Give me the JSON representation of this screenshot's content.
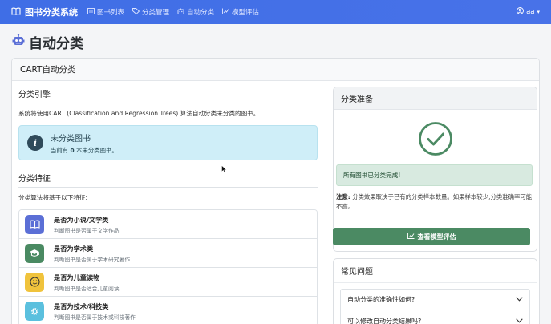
{
  "navbar": {
    "brand": "图书分类系统",
    "items": [
      {
        "label": "图书列表",
        "icon": "list-icon"
      },
      {
        "label": "分类管理",
        "icon": "tags-icon"
      },
      {
        "label": "自动分类",
        "icon": "robot-icon"
      },
      {
        "label": "模型评估",
        "icon": "chart-icon"
      }
    ],
    "user": "aa"
  },
  "page": {
    "title": "自动分类",
    "icon": "robot-icon"
  },
  "main_card": {
    "header": "CART自动分类"
  },
  "engine": {
    "title": "分类引擎",
    "description": "系统将使用CART (Classification and Regression Trees) 算法自动分类未分类的图书。",
    "alert_title": "未分类图书",
    "alert_prefix": "当前有 ",
    "alert_count": "0",
    "alert_suffix": " 本未分类图书。"
  },
  "features": {
    "title": "分类特征",
    "intro": "分类算法将基于以下特征:",
    "items": [
      {
        "title": "是否为小说/文学类",
        "sub": "判断图书是否属于文学作品",
        "icon": "book-icon",
        "color": "#5b6fd6"
      },
      {
        "title": "是否为学术类",
        "sub": "判断图书是否属于学术研究著作",
        "icon": "graduation-cap-icon",
        "color": "#4a8a62"
      },
      {
        "title": "是否为儿童读物",
        "sub": "判断图书是否适合儿童阅读",
        "icon": "smile-icon",
        "color": "#f0c33c"
      },
      {
        "title": "是否为技术/科技类",
        "sub": "判断图书是否属于技术或科技著作",
        "icon": "cog-icon",
        "color": "#5bc0de"
      }
    ]
  },
  "prep": {
    "title": "分类准备",
    "success": "所有图书已分类完成!",
    "note_label": "注意:",
    "note_text": " 分类效果取决于已有的分类样本数量。如果样本较少,分类准确率可能不高。",
    "button": "查看模型评估",
    "check_color": "#4b8a63"
  },
  "faq": {
    "title": "常见问题",
    "items": [
      "自动分类的准确性如何?",
      "可以修改自动分类结果吗?"
    ]
  }
}
